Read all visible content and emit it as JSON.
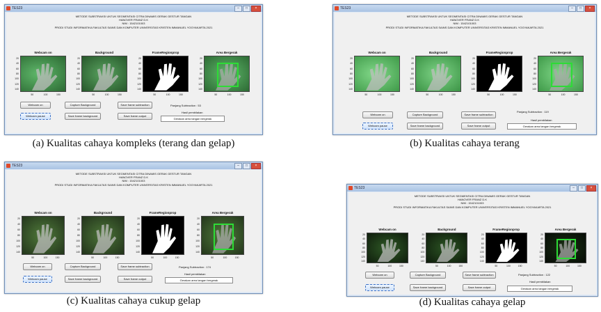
{
  "window_title": "TES23",
  "header": {
    "line1": "METODE SUBSTRAKSI UNTUK SEGMENTASI CITRA DINAMIS GERAK GESTUR TANGAN",
    "line2": "HANOVER FRANZ D.K",
    "line3": "NIM : 1542101003",
    "line4": "PRODI STUDI INFORMATIKA FAKULTAS SAINS DAN KOMPUTER UNIVERSITAS KRISTEN IMMANUEL YOGYAKARTA 2021"
  },
  "axes_titles": [
    "Webcam on",
    "Background",
    "FrameRegionprop",
    "Area Bergerak"
  ],
  "y_ticks": [
    "20",
    "40",
    "60",
    "80",
    "100",
    "120",
    "140"
  ],
  "x_ticks": [
    "50",
    "100",
    "150"
  ],
  "buttons": {
    "webcam_on": "Webcam on",
    "capture_background": "Capture Background",
    "save_frame_subtraction": "Save frame subtraction",
    "webcam_pause": "Webcam pause",
    "save_frame_background": "Save frame background",
    "save_frame_output": "Save frame output"
  },
  "result_label": "Hasil pembilakan",
  "result_value": "Gerakan area tangan bergerak",
  "panels": [
    {
      "subtraction_text": "Panjang Subtraction : 53",
      "caption": "(a) Kualitas cahaya kompleks (terang dan gelap)"
    },
    {
      "subtraction_text": "Panjang Subtraction : 119",
      "caption": "(b) Kualitas cahaya terang"
    },
    {
      "subtraction_text": "Panjang Subtraction : 174",
      "caption": "(c) Kualitas cahaya cukup gelap"
    },
    {
      "subtraction_text": "Panjang Subtraction : 122",
      "caption": "(d) Kualitas cahaya gelap"
    }
  ],
  "colors": {
    "detection_box": "#2ddc36",
    "webcam_green_bright": "#5fb86a",
    "webcam_green_dark": "#1f3a1a",
    "title_bar": "#a9c3e3"
  }
}
